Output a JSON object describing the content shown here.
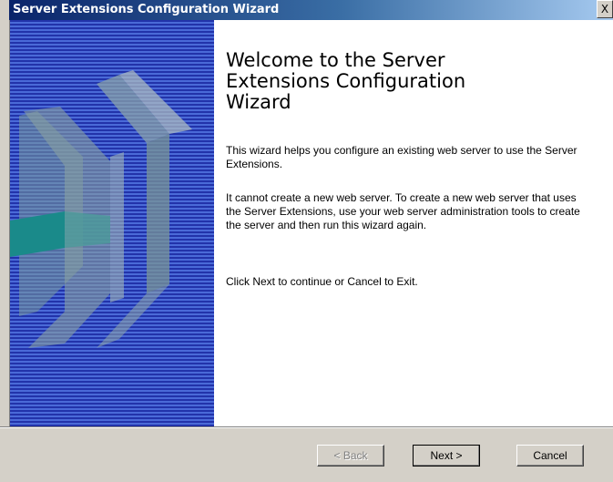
{
  "window": {
    "title": "Server Extensions Configuration Wizard",
    "close_label": "X"
  },
  "main": {
    "heading": "Welcome to the Server Extensions Configuration Wizard",
    "paragraph1": "This wizard helps you configure an existing web server to use the Server Extensions.",
    "paragraph2": "It cannot create a new web server. To create a new web server that uses the Server Extensions, use your web server administration tools to create the server and then run this wizard again.",
    "paragraph3": "Click Next to continue or Cancel to Exit."
  },
  "buttons": {
    "back": "< Back",
    "next": "Next >",
    "cancel": "Cancel"
  },
  "colors": {
    "title_bar": "#0a246a",
    "side_panel": "#2233aa",
    "accent_teal": "#1a8a8a",
    "dialog_face": "#d4d0c8"
  }
}
